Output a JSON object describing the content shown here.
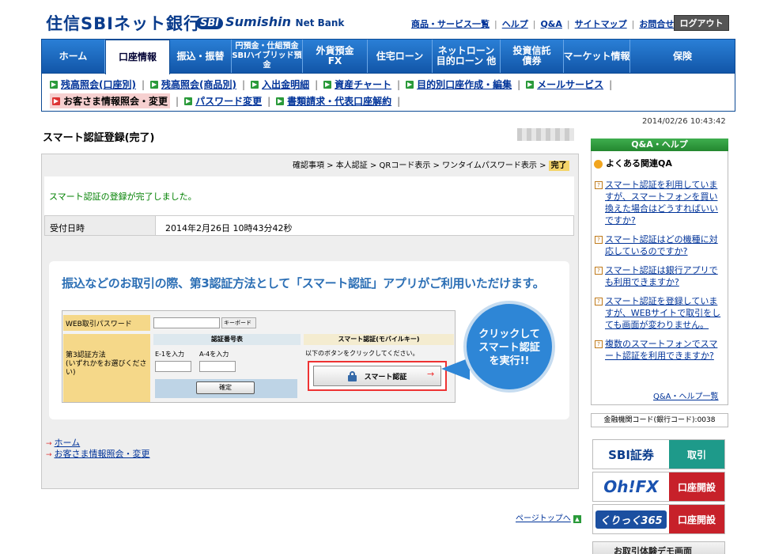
{
  "header": {
    "logo_main": "住信SBIネット銀行",
    "logo_sbi": "SBI",
    "logo_sub": "Sumishin",
    "logo_sub2": "Net Bank",
    "links": [
      "商品・サービス一覧",
      "ヘルプ",
      "Q&A",
      "サイトマップ",
      "お問合せ"
    ],
    "logout": "ログアウト"
  },
  "nav": {
    "tabs": [
      {
        "label": "ホーム"
      },
      {
        "label": "口座情報",
        "active": true
      },
      {
        "label": "振込・振替"
      },
      {
        "label": "円預金・仕組預金\nSBIハイブリッド預金",
        "small": true
      },
      {
        "label": "外貨預金\nFX"
      },
      {
        "label": "住宅ローン"
      },
      {
        "label": "ネットローン\n目的ローン 他"
      },
      {
        "label": "投資信託\n債券"
      },
      {
        "label": "マーケット情報"
      },
      {
        "label": "保険"
      }
    ]
  },
  "subnav": {
    "row1": [
      "残高照会(口座別)",
      "残高照会(商品別)",
      "入出金明細",
      "資産チャート",
      "目的別口座作成・編集",
      "メールサービス"
    ],
    "row2": [
      "お客さま情報照会・変更",
      "パスワード変更",
      "書類請求・代表口座解約"
    ]
  },
  "timestamp": "2014/02/26 10:43:42",
  "page": {
    "title": "スマート認証登録(完了)",
    "steps": [
      "確認事項",
      "本人認証",
      "QRコード表示",
      "ワンタイムパスワード表示"
    ],
    "step_current": "完了",
    "done_message": "スマート認証の登録が完了しました。",
    "receipt_label": "受付日時",
    "receipt_value": "2014年2月26日 10時43分42秒"
  },
  "promo": {
    "headline": "振込などのお取引の際、第3認証方法として「スマート認証」アプリがご利用いただけます。",
    "pw_label": "WEB取引パスワード",
    "keyboard": "キーボード",
    "third_label": "第3認証方法\n(いずれかをお選びください)",
    "code_header": "認証番号表",
    "e1": "E-1を入力",
    "a4": "A-4を入力",
    "confirm": "確定",
    "smart_header": "スマート認証(モバイルキー)",
    "smart_desc": "以下のボタンをクリックしてください。",
    "smart_button": "スマート認証",
    "bubble": "クリックして\nスマート認証\nを実行!!"
  },
  "footer_links": {
    "home": "ホーム",
    "profile": "お客さま情報照会・変更",
    "pagetop": "ページトップへ"
  },
  "sidebar": {
    "qa_header": "Q&A・ヘルプ",
    "qa_title": "よくある関連QA",
    "qa_items": [
      "スマート認証を利用していますが、スマートフォンを買い換えた場合はどうすればいいですか?",
      "スマート認証はどの機種に対応しているのですか?",
      "スマート認証は銀行アプリでも利用できますか?",
      "スマート認証を登録していますが、WEBサイトで取引をしても画面が変わりません。",
      "複数のスマートフォンでスマート認証を利用できますか?"
    ],
    "qa_all": "Q&A・ヘルプ一覧",
    "bank_code": "金融機関コード(銀行コード):0038",
    "banners": [
      {
        "left": "SBI証券",
        "right": "取引"
      },
      {
        "left": "Oh!FX",
        "right": "口座開設"
      },
      {
        "left": "くりっく365",
        "right": "口座開設"
      }
    ],
    "demo": "お取引体験デモ画面"
  }
}
